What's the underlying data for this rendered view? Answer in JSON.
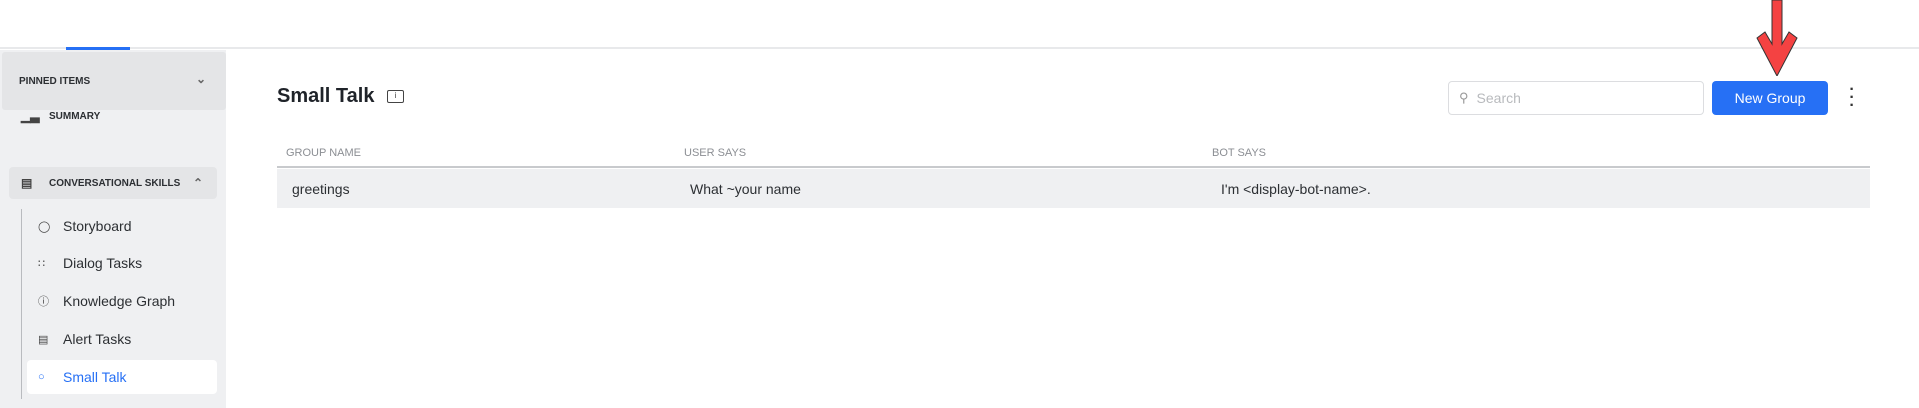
{
  "sidebar": {
    "pinned_label": "PINNED ITEMS",
    "summary_label": "SUMMARY",
    "section_label": "CONVERSATIONAL SKILLS",
    "items": [
      {
        "label": "Storyboard",
        "icon": "storyboard-icon"
      },
      {
        "label": "Dialog Tasks",
        "icon": "dialog-tasks-icon"
      },
      {
        "label": "Knowledge Graph",
        "icon": "question-circle-icon"
      },
      {
        "label": "Alert Tasks",
        "icon": "alert-tasks-icon"
      },
      {
        "label": "Small Talk",
        "icon": "chat-bubble-icon",
        "active": true
      }
    ]
  },
  "main": {
    "title": "Small Talk",
    "search_placeholder": "Search",
    "new_group_label": "New Group",
    "table": {
      "headers": [
        "GROUP NAME",
        "USER SAYS",
        "BOT SAYS"
      ],
      "rows": [
        [
          "greetings",
          "What ~your name",
          "I'm <display-bot-name>."
        ]
      ]
    }
  },
  "colors": {
    "accent": "#2670f5",
    "arrow": "#f44242"
  }
}
